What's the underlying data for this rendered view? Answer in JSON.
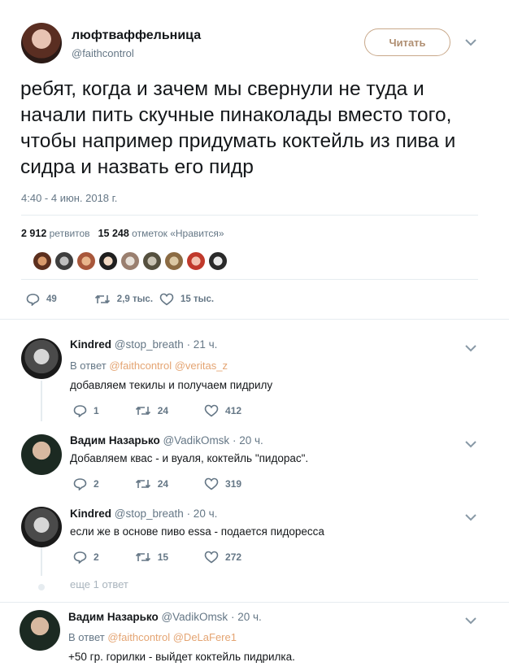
{
  "main": {
    "name": "люфтваффельница",
    "handle": "@faithcontrol",
    "follow_label": "Читать",
    "text": "ребят, когда и зачем мы свернули не туда и начали пить скучные пинаколады вместо того, чтобы например придумать коктейль из пива и сидра и назвать его пидр",
    "time": "4:40 - 4 июн. 2018 г.",
    "retweets_count": "2 912",
    "retweets_label": "ретвитов",
    "likes_count": "15 248",
    "likes_label": "отметок «Нравится»",
    "reply_count": "49",
    "retweet_count_short": "2,9 тыс.",
    "like_count_short": "15 тыс."
  },
  "replies": [
    {
      "name": "Kindred",
      "handle": "@stop_breath",
      "time": "· 21 ч.",
      "in_reply_prefix": "В ответ",
      "in_reply_to": "@faithcontrol @veritas_z",
      "text": "добавляем текилы и получаем пидрилу",
      "replies": "1",
      "retweets": "24",
      "likes": "412"
    },
    {
      "name": "Вадим Назарько",
      "handle": "@VadikOmsk",
      "time": "· 20 ч.",
      "text": "Добавляем квас - и вуаля, коктейль \"пидорас\".",
      "replies": "2",
      "retweets": "24",
      "likes": "319"
    },
    {
      "name": "Kindred",
      "handle": "@stop_breath",
      "time": "· 20 ч.",
      "text": "если же в основе пиво essa - подается пидоресса",
      "replies": "2",
      "retweets": "15",
      "likes": "272"
    },
    {
      "name": "Вадим Назарько",
      "handle": "@VadikOmsk",
      "time": "· 20 ч.",
      "in_reply_prefix": "В ответ",
      "in_reply_to": "@faithcontrol @DeLaFere1",
      "text": "+50 гр. горилки - выйдет коктейль пидрилка."
    }
  ],
  "more_replies": "еще 1 ответ",
  "colors": {
    "text": "#14171a",
    "muted": "#657786",
    "link": "#e4a472",
    "follow_border": "#c8a88a"
  },
  "icons": [
    "reply-icon",
    "retweet-icon",
    "like-icon",
    "chevron-down-icon"
  ]
}
